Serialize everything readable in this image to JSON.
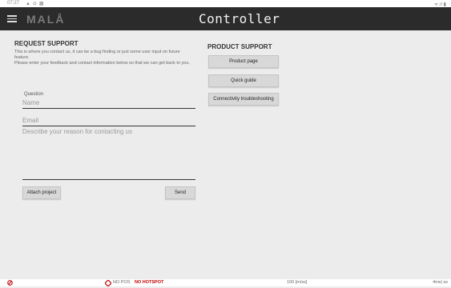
{
  "statusbar": {
    "time": "07:27",
    "sys_icons": "▲ ◘ ▩",
    "right": "ᯤ.ıl ▮"
  },
  "header": {
    "logo": "MALÅ",
    "title": "Controller"
  },
  "request": {
    "heading": "REQUEST SUPPORT",
    "line1": "This is where you contact us, it can be a bug finding or just some user input on future feature.",
    "line2": "Please enter your feedback and contact information below so that we can get back to you.",
    "type_label": "Question",
    "name_placeholder": "Name",
    "email_placeholder": "Email",
    "reason_placeholder": "Describe your reason for contacting us",
    "attach_label": "Attach project",
    "send_label": "Send"
  },
  "product": {
    "heading": "PRODUCT SUPPORT",
    "buttons": [
      "Product page",
      "Quick guide",
      "Connectivity troubleshooting"
    ]
  },
  "bottombar": {
    "gps_status": "NO POS",
    "hotspot": "NO HOTSPOT",
    "speed": "100 [m/ss]",
    "right": "4ms| ss"
  }
}
